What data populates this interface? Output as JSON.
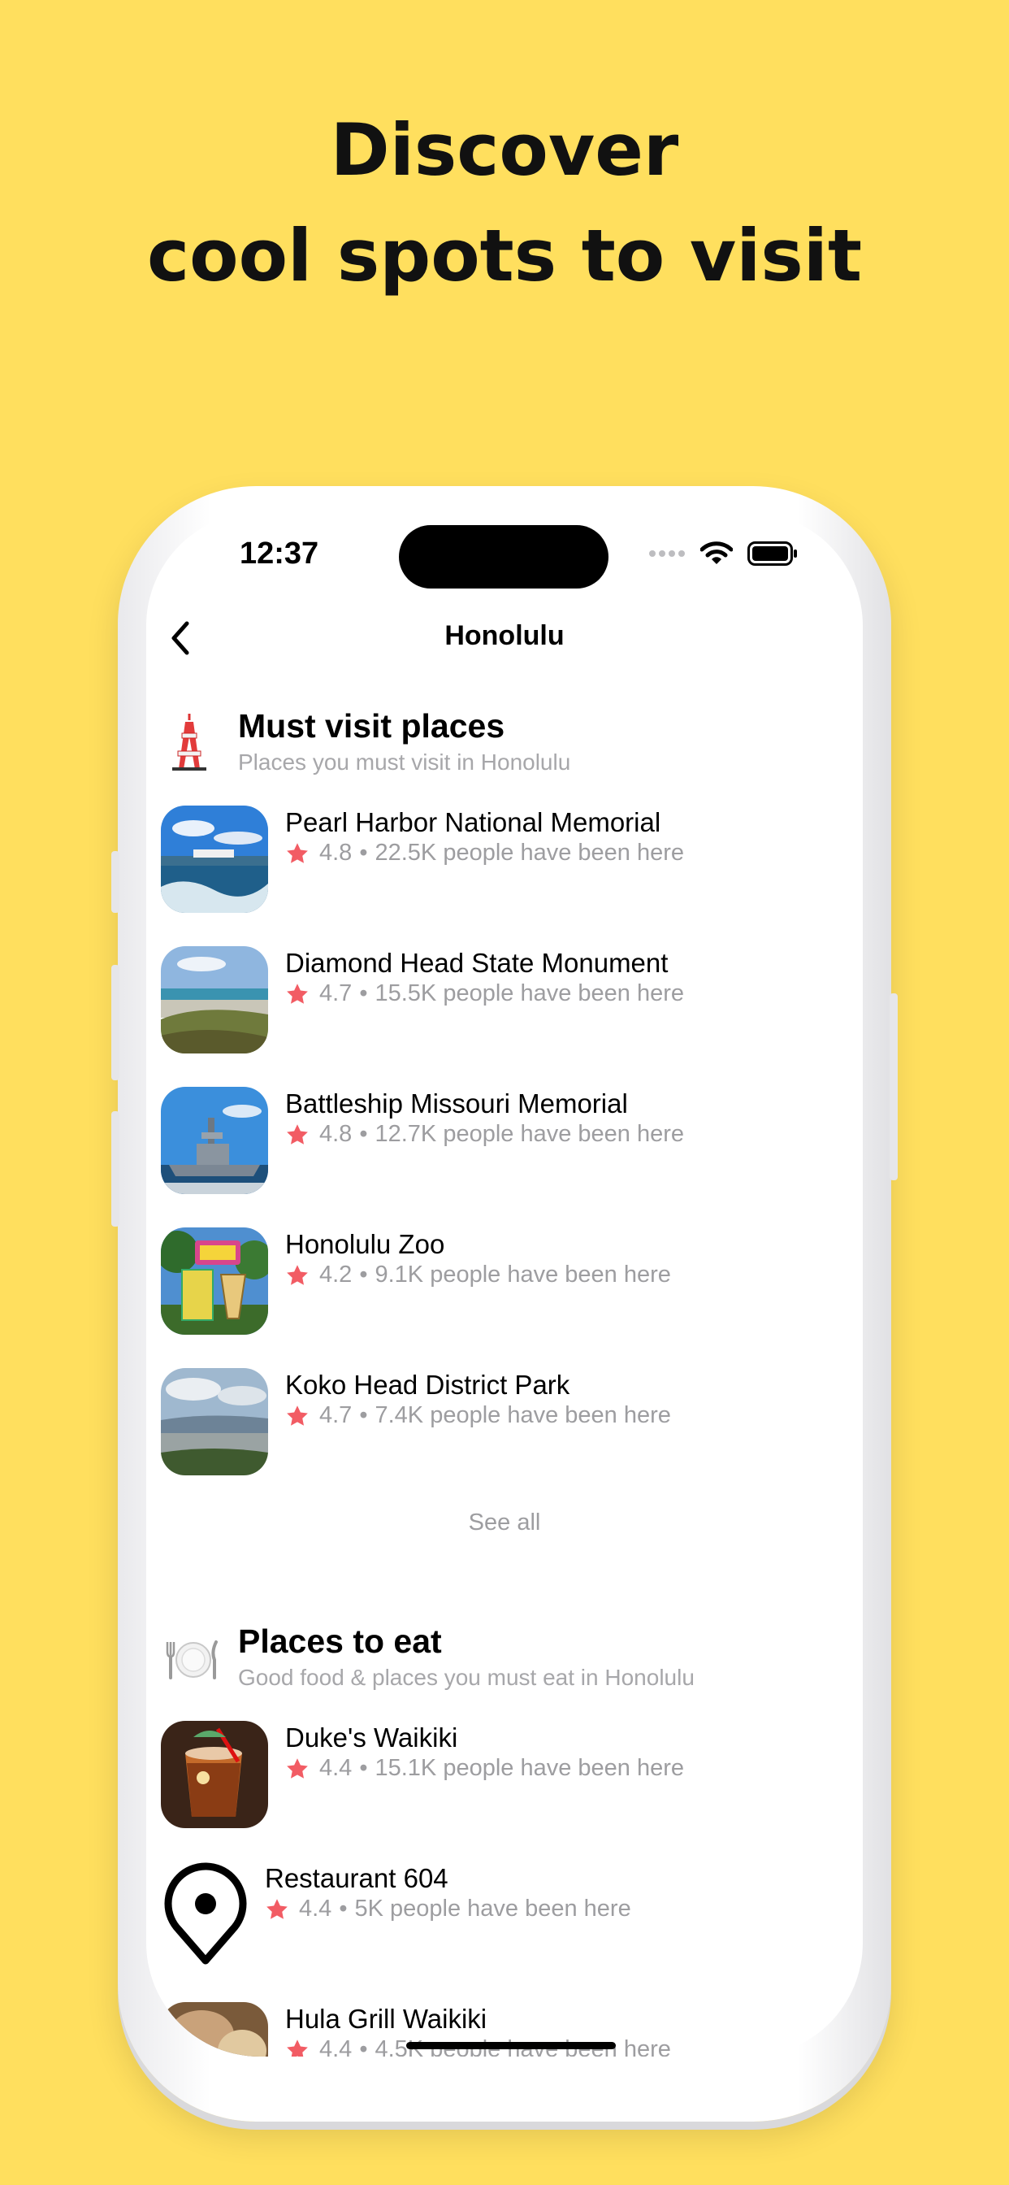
{
  "headline": {
    "line1": "Discover",
    "line2": "cool spots to visit"
  },
  "status_bar": {
    "time": "12:37"
  },
  "nav": {
    "title": "Honolulu"
  },
  "sections": [
    {
      "title": "Must visit places",
      "subtitle": "Places you must visit in Honolulu",
      "icon": "tower-emoji",
      "items": [
        {
          "name": "Pearl Harbor National Memorial",
          "rating": "4.8",
          "visitors": "22.5K people have been here"
        },
        {
          "name": "Diamond Head State Monument",
          "rating": "4.7",
          "visitors": "15.5K people have been here"
        },
        {
          "name": "Battleship Missouri Memorial",
          "rating": "4.8",
          "visitors": "12.7K people have been here"
        },
        {
          "name": "Honolulu Zoo",
          "rating": "4.2",
          "visitors": "9.1K people have been here"
        },
        {
          "name": "Koko Head District Park",
          "rating": "4.7",
          "visitors": "7.4K people have been here"
        }
      ],
      "see_all": "See all"
    },
    {
      "title": "Places to eat",
      "subtitle": "Good food & places you must eat in Honolulu",
      "icon": "plate-cutlery-emoji",
      "items": [
        {
          "name": "Duke's Waikiki",
          "rating": "4.4",
          "visitors": "15.1K people have been here"
        },
        {
          "name": "Restaurant 604",
          "rating": "4.4",
          "visitors": "5K people have been here"
        },
        {
          "name": "Hula Grill Waikiki",
          "rating": "4.4",
          "visitors": "4.5K people have been here"
        }
      ]
    }
  ],
  "colors": {
    "background": "#FFDF5E",
    "star": "#F25C64",
    "muted": "#9D9DA0"
  }
}
